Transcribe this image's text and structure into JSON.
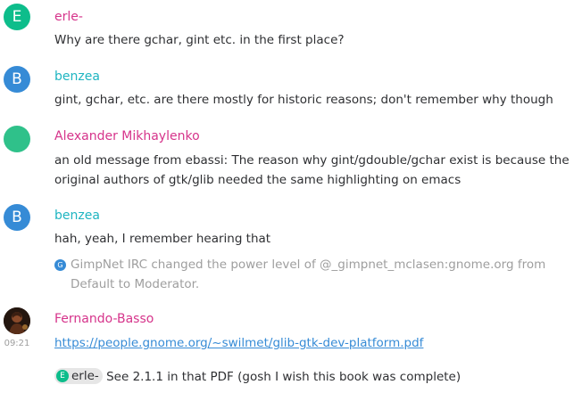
{
  "colors": {
    "green": "#0dbd8b",
    "blue": "#368bd6",
    "magenta": "#d6348b",
    "teal": "#1fb5c1",
    "muted": "#9e9e9e"
  },
  "messages": [
    {
      "avatar_letter": "E",
      "sender": "erle-",
      "body": "Why are there gchar, gint etc. in the first place?"
    },
    {
      "avatar_letter": "B",
      "sender": "benzea",
      "body": "gint, gchar, etc. are there mostly for historic reasons; don't remember why though"
    },
    {
      "avatar_letter": "",
      "sender": "Alexander Mikhaylenko",
      "body": "an old message from ebassi: The reason why gint/gdouble/gchar exist is because the original authors of gtk/glib needed the same highlighting on emacs"
    },
    {
      "avatar_letter": "B",
      "sender": "benzea",
      "body": "hah, yeah, I remember hearing that"
    }
  ],
  "notice": {
    "icon_letter": "G",
    "text": "GimpNet IRC changed the power level of @_gimpnet_mclasen:gnome.org from Default to Moderator."
  },
  "last_message": {
    "sender": "Fernando-Basso",
    "timestamp": "09:21",
    "link": "https://people.gnome.org/~swilmet/glib-gtk-dev-platform.pdf",
    "reply_pill_letter": "E",
    "reply_pill_name": "erle-",
    "reply_text": "See 2.1.1 in that PDF (gosh I wish this book was complete)"
  }
}
